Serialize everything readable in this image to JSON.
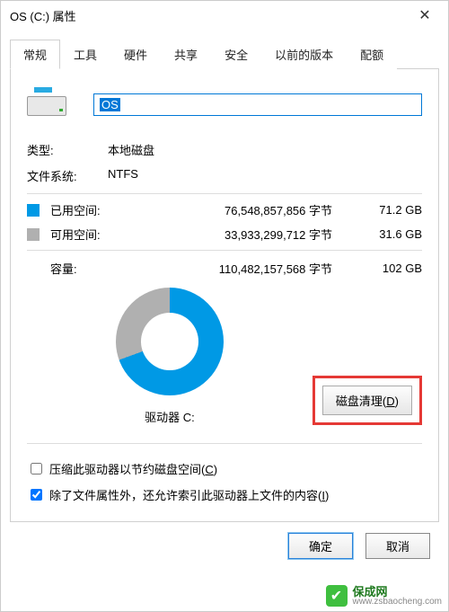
{
  "window": {
    "title": "OS (C:) 属性"
  },
  "tabs": [
    "常规",
    "工具",
    "硬件",
    "共享",
    "安全",
    "以前的版本",
    "配额"
  ],
  "active_tab": 0,
  "drive": {
    "name_value": "OS",
    "type_label": "类型:",
    "type_value": "本地磁盘",
    "fs_label": "文件系统:",
    "fs_value": "NTFS"
  },
  "space": {
    "used_label": "已用空间:",
    "used_bytes": "76,548,857,856 字节",
    "used_human": "71.2 GB",
    "free_label": "可用空间:",
    "free_bytes": "33,933,299,712 字节",
    "free_human": "31.6 GB",
    "cap_label": "容量:",
    "cap_bytes": "110,482,157,568 字节",
    "cap_human": "102 GB"
  },
  "chart_data": {
    "type": "pie",
    "title": "驱动器 C:",
    "series": [
      {
        "name": "已用空间",
        "value": 71.2,
        "color": "#0099e5"
      },
      {
        "name": "可用空间",
        "value": 31.6,
        "color": "#b0b0b0"
      }
    ]
  },
  "drive_label": "驱动器 C:",
  "cleanup": {
    "label": "磁盘清理(",
    "accel": "D",
    "suffix": ")"
  },
  "checks": {
    "compress": {
      "checked": false,
      "label": "压缩此驱动器以节约磁盘空间(",
      "accel": "C",
      "suffix": ")"
    },
    "index": {
      "checked": true,
      "label": "除了文件属性外，还允许索引此驱动器上文件的内容(",
      "accel": "I",
      "suffix": ")"
    }
  },
  "buttons": {
    "ok": "确定",
    "cancel": "取消"
  },
  "watermark": {
    "name": "保成网",
    "url": "www.zsbaocheng.com"
  }
}
